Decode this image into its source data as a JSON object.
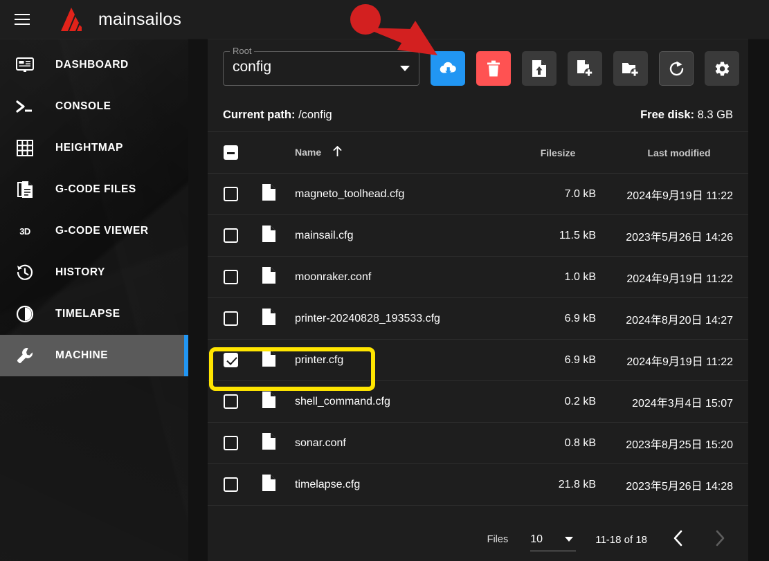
{
  "appbar": {
    "menu_icon": "hamburger-icon",
    "logo_icon": "mainsail-logo",
    "title": "mainsailos"
  },
  "sidebar": {
    "items": [
      {
        "label": "DASHBOARD",
        "icon": "dashboard-icon",
        "active": false
      },
      {
        "label": "CONSOLE",
        "icon": "console-icon",
        "active": false
      },
      {
        "label": "HEIGHTMAP",
        "icon": "heightmap-icon",
        "active": false
      },
      {
        "label": "G-CODE FILES",
        "icon": "gcode-files-icon",
        "active": false
      },
      {
        "label": "G-CODE VIEWER",
        "icon": "3d-icon",
        "active": false
      },
      {
        "label": "HISTORY",
        "icon": "history-icon",
        "active": false
      },
      {
        "label": "TIMELAPSE",
        "icon": "timelapse-icon",
        "active": false
      },
      {
        "label": "MACHINE",
        "icon": "wrench-icon",
        "active": true
      }
    ],
    "active_indicator_color": "#2196F3"
  },
  "toolbar": {
    "root_select": {
      "label": "Root",
      "value": "config"
    },
    "buttons": [
      {
        "name": "download-button",
        "icon": "cloud-download-icon",
        "style": "primary",
        "color": "#2196F3"
      },
      {
        "name": "delete-button",
        "icon": "trash-icon",
        "style": "danger",
        "color": "#FF5252"
      },
      {
        "name": "upload-file-button",
        "icon": "file-upload-icon",
        "style": "plain",
        "color": "#3A3A3A"
      },
      {
        "name": "new-file-button",
        "icon": "file-plus-icon",
        "style": "plain",
        "color": "#3A3A3A"
      },
      {
        "name": "new-folder-button",
        "icon": "folder-plus-icon",
        "style": "plain",
        "color": "#3A3A3A"
      },
      {
        "name": "refresh-button",
        "icon": "refresh-icon",
        "style": "outlined",
        "color": "#3A3A3A"
      },
      {
        "name": "settings-button",
        "icon": "gear-icon",
        "style": "plain",
        "color": "#3A3A3A"
      }
    ]
  },
  "pathbar": {
    "current_path_label": "Current path:",
    "current_path_value": "/config",
    "free_disk_label": "Free disk:",
    "free_disk_value": "8.3 GB"
  },
  "table": {
    "select_all_state": "indeterminate",
    "columns": [
      "Name",
      "Filesize",
      "Last modified"
    ],
    "sort_column": "Name",
    "sort_direction": "asc",
    "rows": [
      {
        "checked": false,
        "icon": "file-icon",
        "name": "magneto_toolhead.cfg",
        "size": "7.0 kB",
        "modified": "2024年9月19日 11:22"
      },
      {
        "checked": false,
        "icon": "file-icon",
        "name": "mainsail.cfg",
        "size": "11.5 kB",
        "modified": "2023年5月26日 14:26"
      },
      {
        "checked": false,
        "icon": "file-icon",
        "name": "moonraker.conf",
        "size": "1.0 kB",
        "modified": "2024年9月19日 11:22"
      },
      {
        "checked": false,
        "icon": "file-icon",
        "name": "printer-20240828_193533.cfg",
        "size": "6.9 kB",
        "modified": "2024年8月20日 14:27"
      },
      {
        "checked": true,
        "icon": "file-icon",
        "name": "printer.cfg",
        "size": "6.9 kB",
        "modified": "2024年9月19日 11:22"
      },
      {
        "checked": false,
        "icon": "file-icon",
        "name": "shell_command.cfg",
        "size": "0.2 kB",
        "modified": "2024年3月4日 15:07"
      },
      {
        "checked": false,
        "icon": "file-icon",
        "name": "sonar.conf",
        "size": "0.8 kB",
        "modified": "2023年8月25日 15:20"
      },
      {
        "checked": false,
        "icon": "file-icon",
        "name": "timelapse.cfg",
        "size": "21.8 kB",
        "modified": "2023年5月26日 14:28"
      }
    ]
  },
  "pagination": {
    "files_label": "Files",
    "per_page": "10",
    "range": "11-18 of 18",
    "prev_icon": "chevron-left-icon",
    "next_icon": "chevron-right-icon",
    "prev_enabled": true,
    "next_enabled": false
  },
  "annotations": {
    "arrow": {
      "name": "red-arrow-annotation",
      "color": "#D32020",
      "points_to": "download-button"
    },
    "highlight_box": {
      "name": "yellow-highlight-annotation",
      "color": "#FFE500",
      "highlights": "printer.cfg row"
    }
  }
}
